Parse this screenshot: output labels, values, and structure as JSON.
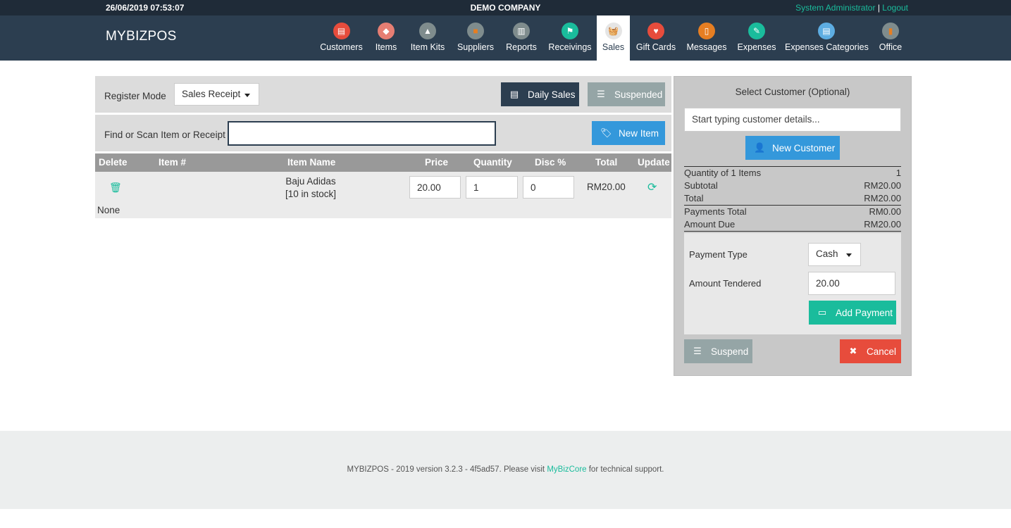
{
  "topbar": {
    "datetime": "26/06/2019 07:53:07",
    "company": "DEMO COMPANY",
    "user": "System Administrator",
    "separator": "|",
    "logout": "Logout"
  },
  "brand": "MYBIZPOS",
  "nav": [
    {
      "label": "Customers",
      "icon": "customers-icon",
      "color": "#e74c3c"
    },
    {
      "label": "Items",
      "icon": "items-icon",
      "color": "#e67e73"
    },
    {
      "label": "Item Kits",
      "icon": "item-kits-icon",
      "color": "#7f8c8d"
    },
    {
      "label": "Suppliers",
      "icon": "suppliers-icon",
      "color": "#e67e22"
    },
    {
      "label": "Reports",
      "icon": "reports-icon",
      "color": "#7f8c8d"
    },
    {
      "label": "Receivings",
      "icon": "receivings-icon",
      "color": "#1abc9c"
    },
    {
      "label": "Sales",
      "icon": "sales-icon",
      "color": "#95a5a6"
    },
    {
      "label": "Gift Cards",
      "icon": "gift-cards-icon",
      "color": "#e74c3c"
    },
    {
      "label": "Messages",
      "icon": "messages-icon",
      "color": "#e67e22"
    },
    {
      "label": "Expenses",
      "icon": "expenses-icon",
      "color": "#1abc9c"
    },
    {
      "label": "Expenses Categories",
      "icon": "expenses-categories-icon",
      "color": "#5dade2"
    },
    {
      "label": "Office",
      "icon": "office-icon",
      "color": "#e67e22"
    }
  ],
  "register": {
    "mode_label": "Register Mode",
    "mode_value": "Sales Receipt",
    "daily_sales": "Daily Sales",
    "suspended": "Suspended",
    "find_label": "Find or Scan Item or Receipt",
    "find_value": "",
    "new_item": "New Item"
  },
  "table": {
    "headers": [
      "Delete",
      "Item #",
      "Item Name",
      "Price",
      "Quantity",
      "Disc %",
      "Total",
      "Update"
    ],
    "rows": [
      {
        "item_no": "",
        "name": "Baju Adidas",
        "stock": "[10 in stock]",
        "price": "20.00",
        "quantity": "1",
        "discount": "0",
        "total": "RM20.00",
        "description": "None"
      }
    ]
  },
  "customer": {
    "title": "Select Customer (Optional)",
    "placeholder": "Start typing customer details...",
    "new_customer": "New Customer"
  },
  "summary": {
    "quantity_label": "Quantity of 1 Items",
    "quantity_value": "1",
    "subtotal_label": "Subtotal",
    "subtotal_value": "RM20.00",
    "total_label": "Total",
    "total_value": "RM20.00",
    "payments_label": "Payments Total",
    "payments_value": "RM0.00",
    "due_label": "Amount Due",
    "due_value": "RM20.00"
  },
  "payment": {
    "type_label": "Payment Type",
    "type_value": "Cash",
    "tendered_label": "Amount Tendered",
    "tendered_value": "20.00",
    "add_payment": "Add Payment"
  },
  "actions": {
    "suspend": "Suspend",
    "cancel": "Cancel"
  },
  "footer": {
    "text_before": "MYBIZPOS - 2019 version 3.2.3 - 4f5ad57. Please visit ",
    "link": "MyBizCore",
    "text_after": " for technical support."
  }
}
